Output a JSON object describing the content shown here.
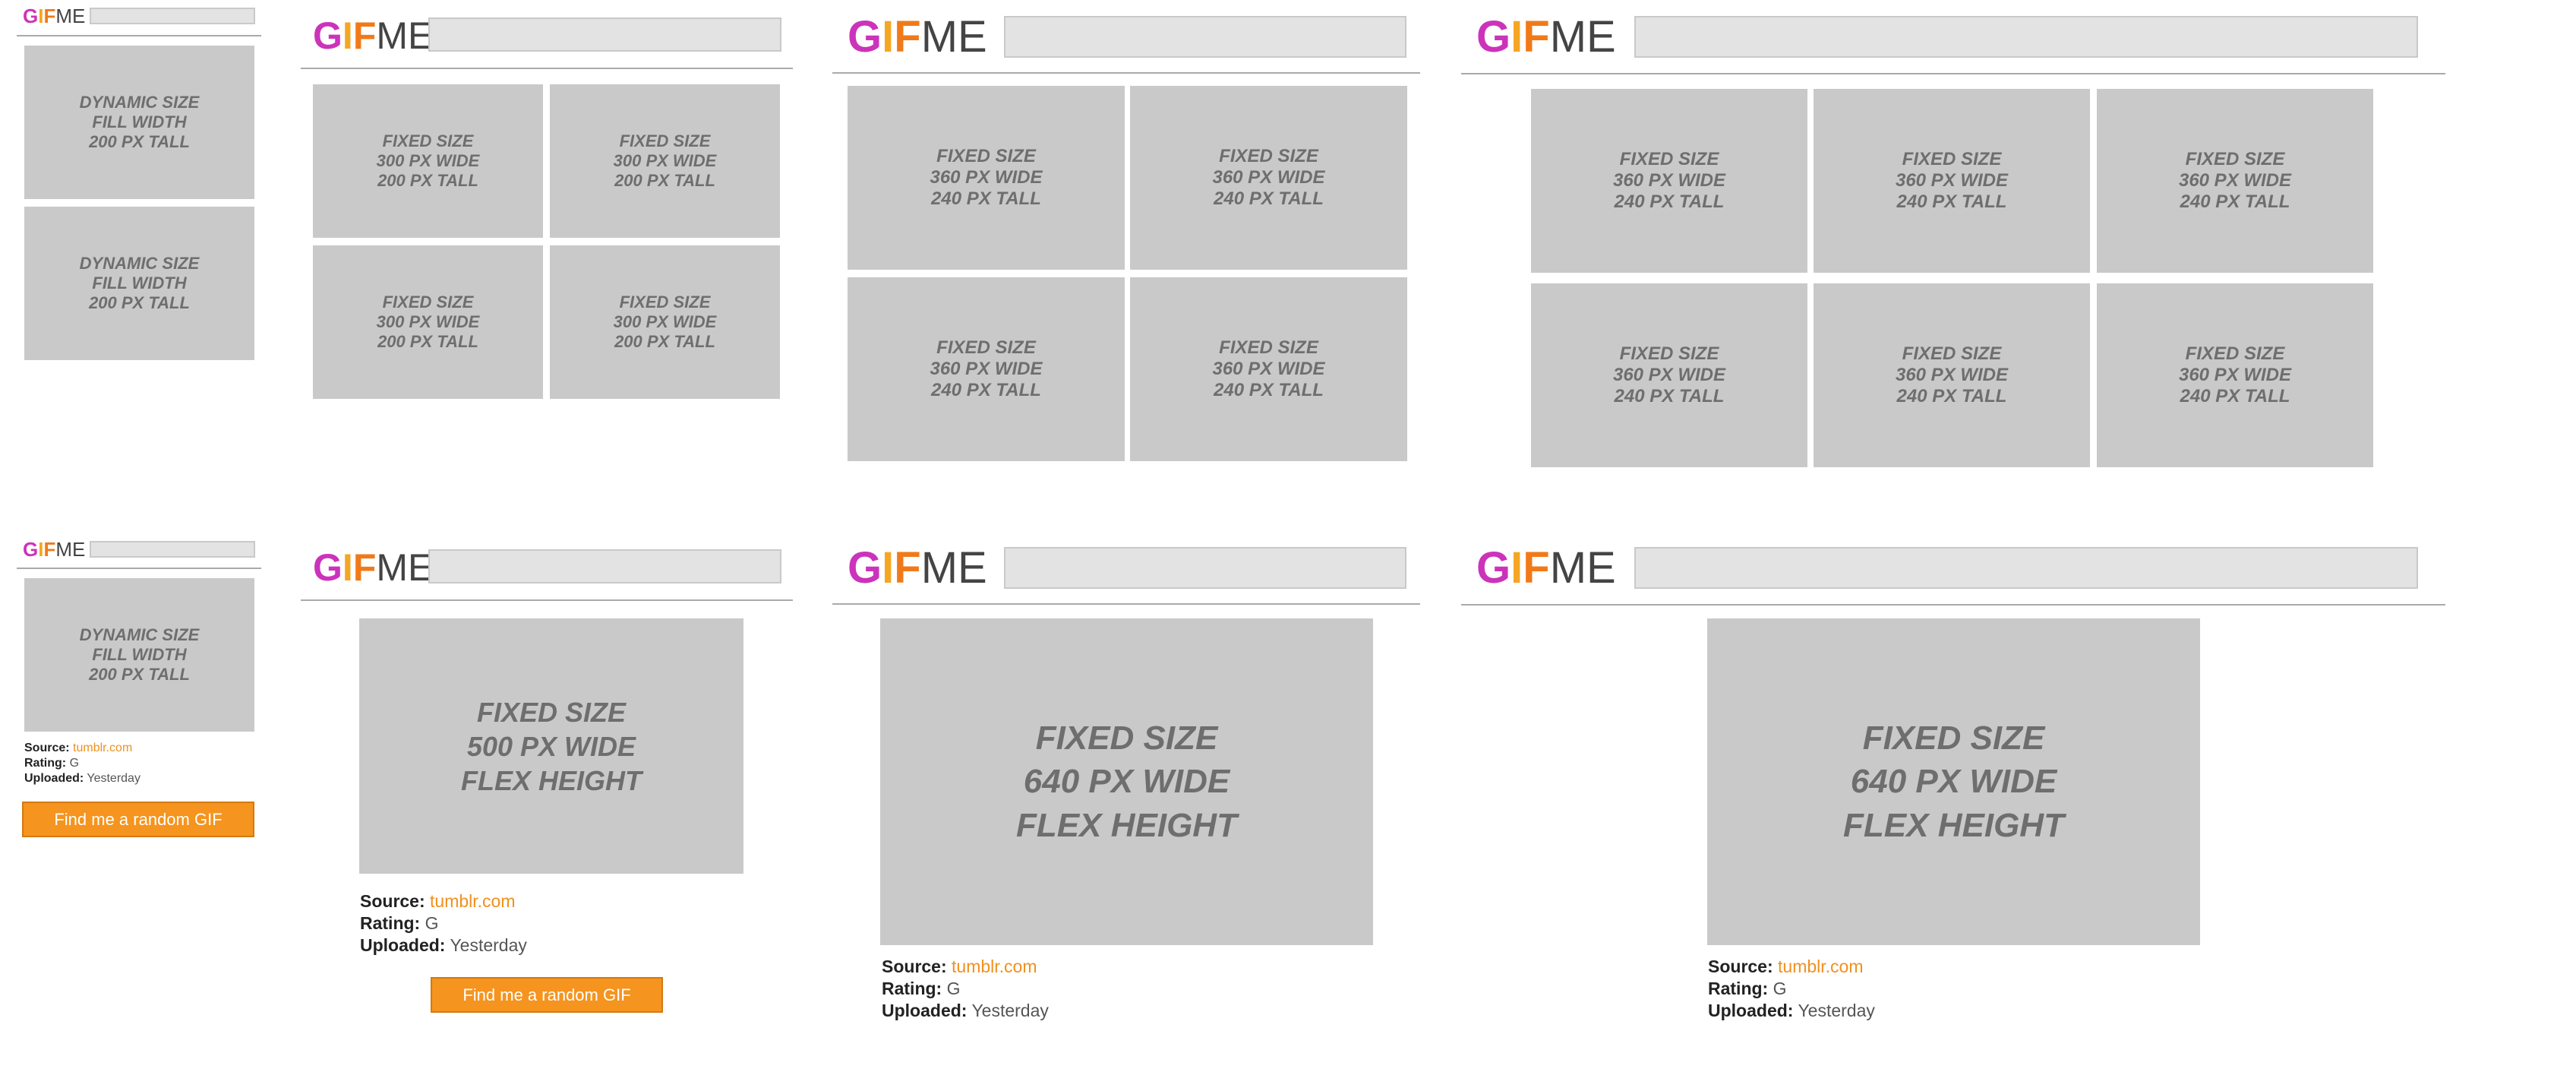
{
  "logo": {
    "g": "G",
    "i": "I",
    "f": "F",
    "me": "ME"
  },
  "tiles": {
    "dynamic": "DYNAMIC SIZE\nFILL WIDTH\n200 PX TALL",
    "fixed300": "FIXED SIZE\n300 PX WIDE\n200 PX TALL",
    "fixed360": "FIXED SIZE\n360 PX WIDE\n240 PX TALL",
    "fixed500": "FIXED SIZE\n500 PX WIDE\nFLEX HEIGHT",
    "fixed640": "FIXED SIZE\n640 PX WIDE\nFLEX HEIGHT"
  },
  "detail": {
    "source_label": "Source:",
    "source_value": "tumblr.com",
    "rating_label": "Rating:",
    "rating_value": "G",
    "uploaded_label": "Uploaded:",
    "uploaded_value": "Yesterday",
    "random_button": "Find me a random GIF"
  },
  "colors": {
    "accent": "#f5941f",
    "logo_g": "#cc33bb",
    "logo_i": "#f5a623",
    "logo_f": "#f07a1a",
    "tile": "#c9c9c9"
  }
}
